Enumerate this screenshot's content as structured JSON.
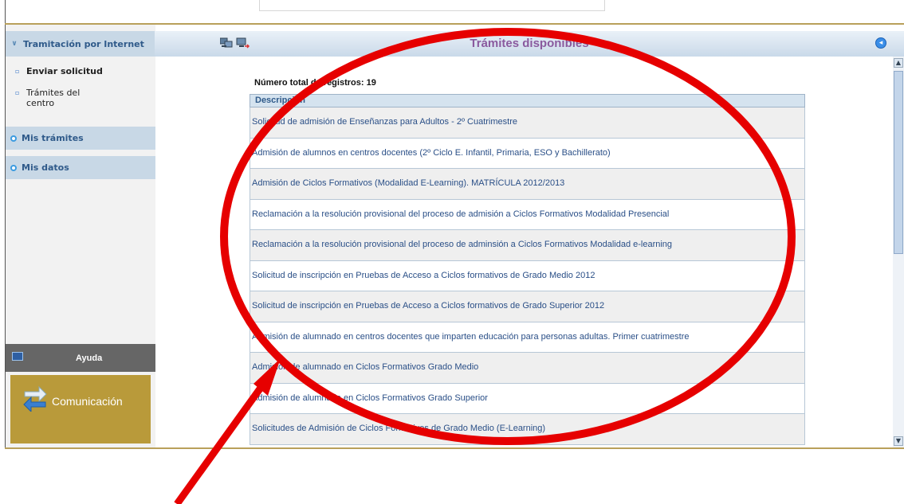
{
  "sidebar": {
    "section_title": "Tramitación por Internet",
    "sub_items": [
      "Enviar solicitud",
      "Trámites del",
      "centro"
    ],
    "items": [
      "Mis trámites",
      "Mis datos"
    ],
    "help_label": "Ayuda",
    "communication_label": "Comunicación"
  },
  "main": {
    "title": "Trámites disponibles",
    "record_count": "Número total de registros: 19",
    "table": {
      "header": "Descripción",
      "rows": [
        "Solicitud de admisión de Enseñanzas para Adultos - 2º Cuatrimestre",
        "Admisión de alumnos en centros docentes (2º Ciclo E. Infantil, Primaria, ESO y Bachillerato)",
        "Admisión de Ciclos Formativos (Modalidad E-Learning). MATRÍCULA 2012/2013",
        "Reclamación a la resolución provisional del proceso de admisión a Ciclos Formativos Modalidad Presencial",
        "Reclamación a la resolución provisional del proceso de adminsión a Ciclos Formativos Modalidad e-learning",
        "Solicitud de inscripción en Pruebas de Acceso a Ciclos formativos de Grado Medio 2012",
        "Solicitud de inscripción en Pruebas de Acceso a Ciclos formativos de Grado Superior 2012",
        "Admisión de alumnado en centros docentes que imparten educación para personas adultas. Primer cuatrimestre",
        "Admisión de alumnado en Ciclos Formativos Grado Medio",
        "Admisión de alumnado en Ciclos Formativos Grado Superior",
        "Solicitudes de Admisión de Ciclos Formativos de Grado Medio (E-Learning)"
      ]
    }
  },
  "icons": {
    "computers": "network-computers-icon",
    "export": "computer-export-icon",
    "back": "back-arrow-circle-icon",
    "help": "book-icon",
    "communication": "exchange-arrows-icon"
  },
  "colors": {
    "annotation": "#e60000",
    "title": "#8a5a9e",
    "border_gold": "#b9a05a",
    "link": "#2a4f87"
  }
}
